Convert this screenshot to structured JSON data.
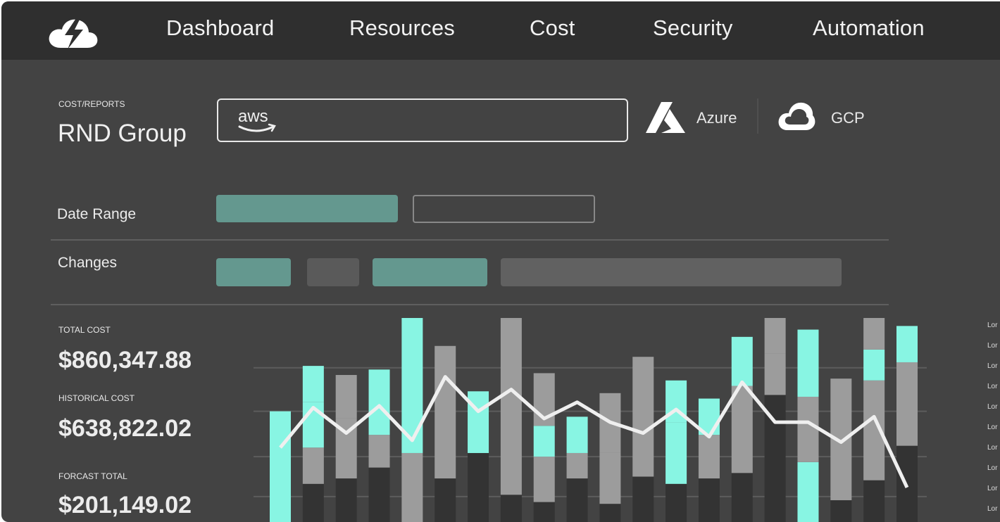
{
  "nav": {
    "items": [
      {
        "label": "Dashboard"
      },
      {
        "label": "Resources"
      },
      {
        "label": "Cost"
      },
      {
        "label": "Security"
      },
      {
        "label": "Automation"
      }
    ]
  },
  "page": {
    "breadcrumb": "COST/REPORTS",
    "title": "RND Group"
  },
  "providers": {
    "aws_label": "aws",
    "azure_label": "Azure",
    "gcp_label": "GCP"
  },
  "filters": {
    "date_range_label": "Date Range",
    "changes_label": "Changes"
  },
  "kpis": {
    "total_cost_label": "TOTAL COST",
    "total_cost_value": "$860,347.88",
    "historical_cost_label": "HISTORICAL COST",
    "historical_cost_value": "$638,822.02",
    "forecast_total_label": "FORCAST TOTAL",
    "forecast_total_value": "$201,149.02"
  },
  "legend": {
    "items": [
      "Lor",
      "Lor",
      "Lor",
      "Lor",
      "Lor",
      "Lor",
      "Lor",
      "Lor",
      "Lor",
      "Lor"
    ]
  },
  "colors": {
    "accent": "#88f5e3",
    "teal_muted": "#64988f",
    "bar_dark": "#333333",
    "bar_gray": "#9c9c9c",
    "line": "#efefef",
    "nav_bg": "#2f2f2f",
    "panel_bg": "#434343"
  },
  "chart_data": {
    "type": "bar",
    "gridlines": true,
    "series": [
      {
        "values": [
          0,
          0.21,
          0.24,
          0.3,
          0,
          0.24,
          0.38,
          0.15,
          0.11,
          0.24,
          0.1,
          0.25,
          0.21,
          0.24,
          0.27,
          0.7,
          0,
          0.12,
          0.23,
          0.42
        ]
      },
      {
        "values": [
          0,
          0.2,
          0.33,
          0.18,
          0.38,
          0.73,
          0,
          0.97,
          0.25,
          0.14,
          0.28,
          0.66,
          0,
          0.24,
          0.48,
          0.23,
          0,
          0.67,
          0.55,
          0.46
        ]
      },
      {
        "values": [
          0.61,
          0.25,
          0,
          0.36,
          0.93,
          0,
          0.34,
          0,
          0.17,
          0.2,
          0,
          0,
          0.34,
          0,
          0.27,
          0,
          0.33,
          0,
          0.17,
          0.2
        ]
      },
      {
        "values": [
          0,
          0,
          0.24,
          0,
          0,
          0,
          0,
          0.37,
          0.29,
          0,
          0.33,
          0,
          0,
          0,
          0,
          0.29,
          0.36,
          0,
          0.31,
          0
        ]
      },
      {
        "values": [
          0,
          0.2,
          0,
          0,
          0,
          0,
          0,
          0,
          0,
          0,
          0,
          0,
          0.23,
          0.2,
          0,
          0,
          0.37,
          0,
          0,
          0
        ]
      },
      {
        "values": [
          0,
          0,
          0,
          0,
          0,
          0,
          0,
          0,
          0,
          0,
          0,
          0,
          0,
          0,
          0,
          0,
          0,
          0,
          0,
          0
        ]
      }
    ],
    "line_values": [
      0.41,
      0.63,
      0.49,
      0.64,
      0.45,
      0.8,
      0.61,
      0.73,
      0.57,
      0.66,
      0.55,
      0.49,
      0.62,
      0.47,
      0.77,
      0.55,
      0.55,
      0.44,
      0.58,
      0.19
    ]
  }
}
